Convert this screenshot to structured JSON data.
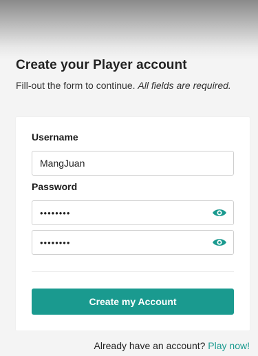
{
  "header": {
    "title": "Create your Player account",
    "subtitle_plain": "Fill-out the form to continue. ",
    "subtitle_emphasis": "All fields are required."
  },
  "form": {
    "username_label": "Username",
    "username_value": "MangJuan",
    "password_label": "Password",
    "password_mask": "••••••••",
    "confirm_mask": "••••••••",
    "password_toggle_icon": "eye-icon",
    "submit_label": "Create my Account"
  },
  "footer": {
    "prompt": "Already have an account?",
    "link_label": "Play now!"
  },
  "colors": {
    "accent": "#1a9a8f",
    "background": "#f4f4f4",
    "card": "#ffffff"
  }
}
